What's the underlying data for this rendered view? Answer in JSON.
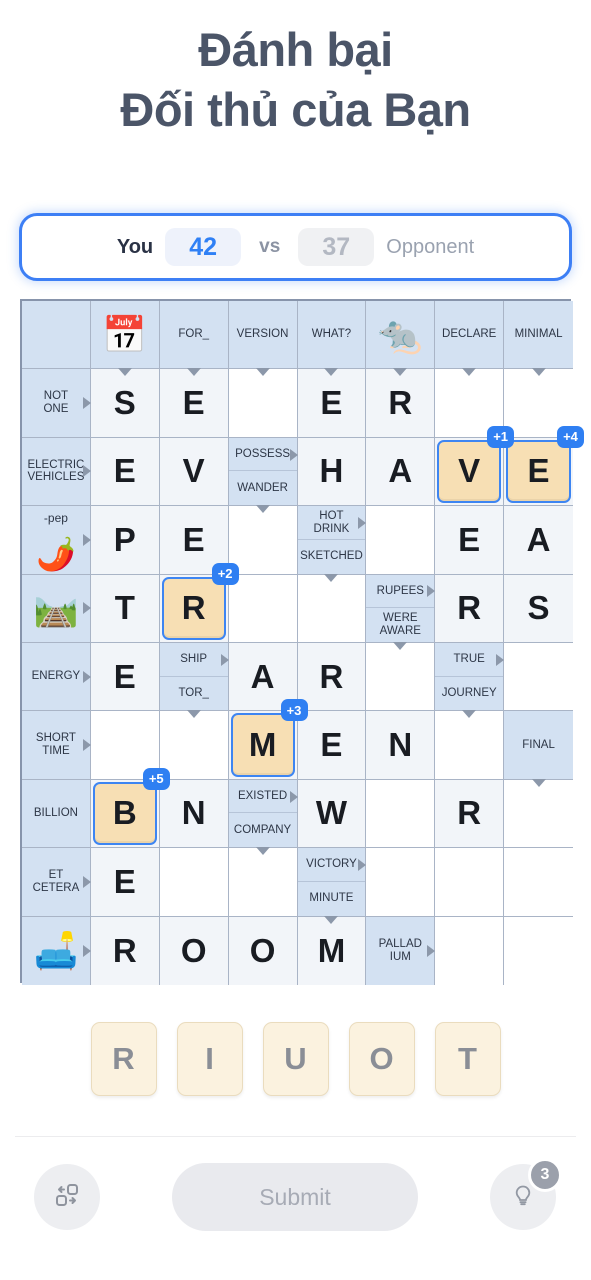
{
  "header": {
    "title_line1": "Đánh bại",
    "title_line2": "Đối thủ của Bạn"
  },
  "scorebar": {
    "you_label": "You",
    "you_score": "42",
    "vs_label": "vs",
    "opponent_score": "37",
    "opponent_label": "Opponent",
    "accent_color": "#3d7ff5",
    "you_score_color": "#2f80f5",
    "opponent_score_color": "#b3b8c2"
  },
  "grid": {
    "columns": 8,
    "rows": 10,
    "colors": {
      "clue_cell": "#d3e1f2",
      "letter_cell": "#f2f5f9",
      "empty_cell": "#ffffff",
      "grid_line": "#a9b4c6",
      "grid_border": "#8794ab",
      "tile_fill": "#f7dfb4",
      "tile_border": "#3d85f2",
      "badge": "#2f7ff2"
    },
    "cells": [
      {
        "r": 0,
        "c": 0,
        "type": "clue"
      },
      {
        "r": 0,
        "c": 1,
        "type": "clue",
        "emoji": "📅",
        "arrow": "down",
        "emoji_name": "calendar-september-emoji"
      },
      {
        "r": 0,
        "c": 2,
        "type": "clue",
        "text": "FOR_",
        "arrow": "down"
      },
      {
        "r": 0,
        "c": 3,
        "type": "clue",
        "text": "VERSION",
        "arrow": "down"
      },
      {
        "r": 0,
        "c": 4,
        "type": "clue",
        "text": "WHAT?",
        "arrow": "down"
      },
      {
        "r": 0,
        "c": 5,
        "type": "clue",
        "emoji": "🐀",
        "arrow": "down",
        "emoji_name": "rat-emoji"
      },
      {
        "r": 0,
        "c": 6,
        "type": "clue",
        "text": "DECLARE",
        "arrow": "down"
      },
      {
        "r": 0,
        "c": 7,
        "type": "clue",
        "text": "MINIMAL",
        "arrow": "down"
      },
      {
        "r": 1,
        "c": 0,
        "type": "clue",
        "text": "NOT\nONE",
        "arrow": "right"
      },
      {
        "r": 1,
        "c": 1,
        "type": "letter",
        "letter": "S"
      },
      {
        "r": 1,
        "c": 2,
        "type": "letter",
        "letter": "E"
      },
      {
        "r": 1,
        "c": 3,
        "type": "empty"
      },
      {
        "r": 1,
        "c": 4,
        "type": "letter",
        "letter": "E"
      },
      {
        "r": 1,
        "c": 5,
        "type": "letter",
        "letter": "R"
      },
      {
        "r": 1,
        "c": 6,
        "type": "empty"
      },
      {
        "r": 1,
        "c": 7,
        "type": "empty"
      },
      {
        "r": 2,
        "c": 0,
        "type": "clue",
        "text": "ELECTRIC\nVEHICLES",
        "arrow": "right"
      },
      {
        "r": 2,
        "c": 1,
        "type": "letter",
        "letter": "E"
      },
      {
        "r": 2,
        "c": 2,
        "type": "letter",
        "letter": "V"
      },
      {
        "r": 2,
        "c": 3,
        "type": "split",
        "top": "POSSESS",
        "bottom": "WANDER",
        "arrow_top": "right",
        "arrow_bottom": "down"
      },
      {
        "r": 2,
        "c": 4,
        "type": "letter",
        "letter": "H"
      },
      {
        "r": 2,
        "c": 5,
        "type": "letter",
        "letter": "A"
      },
      {
        "r": 2,
        "c": 6,
        "type": "letter",
        "tile": "V",
        "badge": "+1"
      },
      {
        "r": 2,
        "c": 7,
        "type": "letter",
        "tile": "E",
        "badge": "+4"
      },
      {
        "r": 3,
        "c": 0,
        "type": "clue",
        "sub": "-pep",
        "emoji": "🌶️",
        "arrow": "right",
        "emoji_name": "chili-pepper-emoji"
      },
      {
        "r": 3,
        "c": 1,
        "type": "letter",
        "letter": "P"
      },
      {
        "r": 3,
        "c": 2,
        "type": "letter",
        "letter": "E"
      },
      {
        "r": 3,
        "c": 3,
        "type": "empty"
      },
      {
        "r": 3,
        "c": 4,
        "type": "split",
        "top": "HOT\nDRINK",
        "bottom": "SKETCHED",
        "arrow_top": "right",
        "arrow_bottom": "down"
      },
      {
        "r": 3,
        "c": 5,
        "type": "empty"
      },
      {
        "r": 3,
        "c": 6,
        "type": "letter",
        "letter": "E"
      },
      {
        "r": 3,
        "c": 7,
        "type": "letter",
        "letter": "A"
      },
      {
        "r": 4,
        "c": 0,
        "type": "clue",
        "emoji": "🛤️",
        "arrow": "right",
        "emoji_name": "winding-road-emoji"
      },
      {
        "r": 4,
        "c": 1,
        "type": "letter",
        "letter": "T"
      },
      {
        "r": 4,
        "c": 2,
        "type": "letter",
        "tile": "R",
        "badge": "+2"
      },
      {
        "r": 4,
        "c": 3,
        "type": "empty"
      },
      {
        "r": 4,
        "c": 4,
        "type": "empty"
      },
      {
        "r": 4,
        "c": 5,
        "type": "split",
        "top": "RUPEES",
        "bottom": "WERE\nAWARE",
        "arrow_top": "right",
        "arrow_bottom": "down"
      },
      {
        "r": 4,
        "c": 6,
        "type": "letter",
        "letter": "R"
      },
      {
        "r": 4,
        "c": 7,
        "type": "letter",
        "letter": "S"
      },
      {
        "r": 5,
        "c": 0,
        "type": "clue",
        "text": "ENERGY",
        "arrow": "right"
      },
      {
        "r": 5,
        "c": 1,
        "type": "letter",
        "letter": "E"
      },
      {
        "r": 5,
        "c": 2,
        "type": "split",
        "top": "SHIP",
        "bottom": "TOR_",
        "arrow_top": "right",
        "arrow_bottom": "down"
      },
      {
        "r": 5,
        "c": 3,
        "type": "letter",
        "letter": "A"
      },
      {
        "r": 5,
        "c": 4,
        "type": "letter",
        "letter": "R"
      },
      {
        "r": 5,
        "c": 5,
        "type": "empty"
      },
      {
        "r": 5,
        "c": 6,
        "type": "split",
        "top": "TRUE",
        "bottom": "JOURNEY",
        "arrow_top": "right",
        "arrow_bottom": "down"
      },
      {
        "r": 5,
        "c": 7,
        "type": "empty"
      },
      {
        "r": 6,
        "c": 0,
        "type": "clue",
        "text": "SHORT\nTIME",
        "arrow": "right"
      },
      {
        "r": 6,
        "c": 1,
        "type": "empty"
      },
      {
        "r": 6,
        "c": 2,
        "type": "empty"
      },
      {
        "r": 6,
        "c": 3,
        "type": "letter",
        "tile": "M",
        "badge": "+3"
      },
      {
        "r": 6,
        "c": 4,
        "type": "letter",
        "letter": "E"
      },
      {
        "r": 6,
        "c": 5,
        "type": "letter",
        "letter": "N"
      },
      {
        "r": 6,
        "c": 6,
        "type": "empty"
      },
      {
        "r": 6,
        "c": 7,
        "type": "clue",
        "text": "FINAL",
        "arrow": "down"
      },
      {
        "r": 7,
        "c": 0,
        "type": "clue",
        "text": "BILLION"
      },
      {
        "r": 7,
        "c": 1,
        "type": "letter",
        "tile": "B",
        "badge": "+5"
      },
      {
        "r": 7,
        "c": 2,
        "type": "letter",
        "letter": "N"
      },
      {
        "r": 7,
        "c": 3,
        "type": "split",
        "top": "EXISTED",
        "bottom": "COMPANY",
        "arrow_top": "right",
        "arrow_bottom": "down"
      },
      {
        "r": 7,
        "c": 4,
        "type": "letter",
        "letter": "W"
      },
      {
        "r": 7,
        "c": 5,
        "type": "empty"
      },
      {
        "r": 7,
        "c": 6,
        "type": "letter",
        "letter": "R"
      },
      {
        "r": 7,
        "c": 7,
        "type": "empty"
      },
      {
        "r": 8,
        "c": 0,
        "type": "clue",
        "text": "ET\nCETERA",
        "arrow": "right"
      },
      {
        "r": 8,
        "c": 1,
        "type": "letter",
        "letter": "E"
      },
      {
        "r": 8,
        "c": 2,
        "type": "empty"
      },
      {
        "r": 8,
        "c": 3,
        "type": "empty"
      },
      {
        "r": 8,
        "c": 4,
        "type": "split",
        "top": "VICTORY",
        "bottom": "MINUTE",
        "arrow_top": "right",
        "arrow_bottom": "down"
      },
      {
        "r": 8,
        "c": 5,
        "type": "empty"
      },
      {
        "r": 8,
        "c": 6,
        "type": "empty"
      },
      {
        "r": 8,
        "c": 7,
        "type": "empty"
      },
      {
        "r": 9,
        "c": 0,
        "type": "clue",
        "emoji": "🛋️",
        "arrow": "right",
        "emoji_name": "couch-lamp-emoji"
      },
      {
        "r": 9,
        "c": 1,
        "type": "letter",
        "letter": "R"
      },
      {
        "r": 9,
        "c": 2,
        "type": "letter",
        "letter": "O"
      },
      {
        "r": 9,
        "c": 3,
        "type": "letter",
        "letter": "O"
      },
      {
        "r": 9,
        "c": 4,
        "type": "letter",
        "letter": "M"
      },
      {
        "r": 9,
        "c": 5,
        "type": "clue",
        "text": "PALLAD\nIUM",
        "arrow": "right"
      },
      {
        "r": 9,
        "c": 6,
        "type": "empty"
      },
      {
        "r": 9,
        "c": 7,
        "type": "empty"
      }
    ]
  },
  "rack": {
    "tiles": [
      "R",
      "I",
      "U",
      "O",
      "T"
    ]
  },
  "bottom": {
    "shuffle_icon": "shuffle-icon",
    "submit_label": "Submit",
    "hint_icon": "lightbulb-icon",
    "hint_count": "3"
  }
}
